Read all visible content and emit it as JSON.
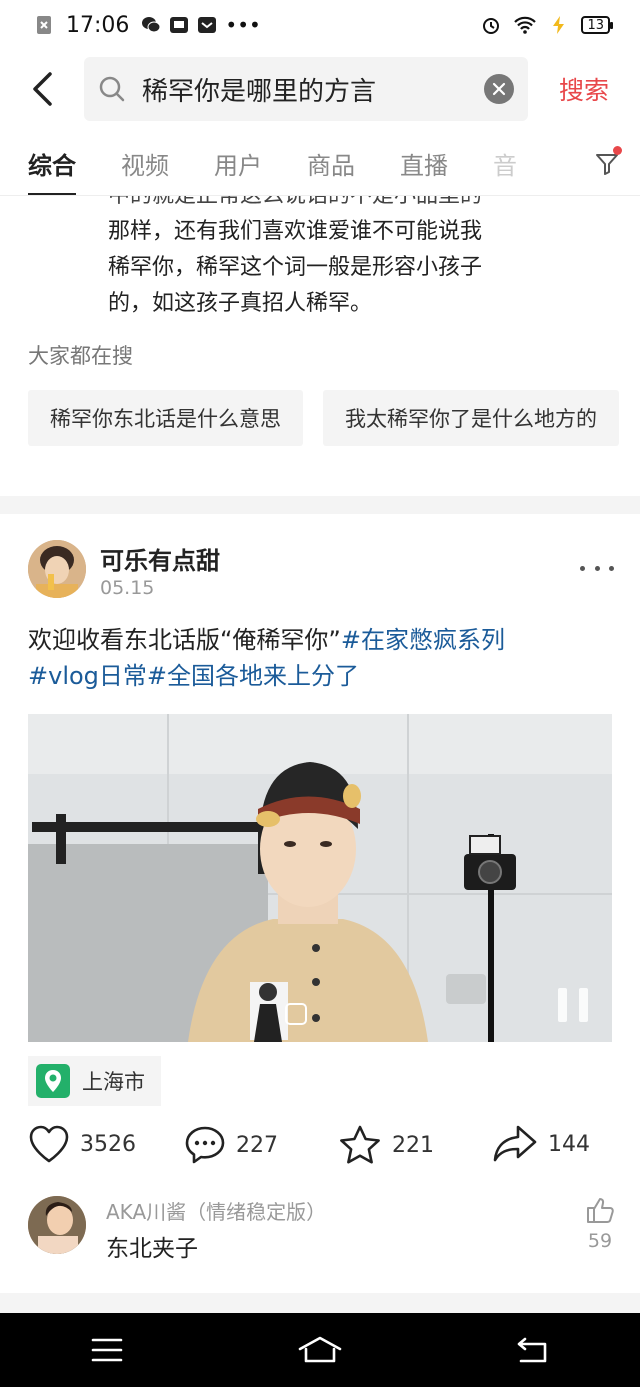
{
  "status_bar": {
    "time": "17:06",
    "battery": "13"
  },
  "search": {
    "query": "稀罕你是哪里的方言",
    "submit_label": "搜索"
  },
  "tabs": [
    {
      "label": "综合"
    },
    {
      "label": "视频"
    },
    {
      "label": "用户"
    },
    {
      "label": "商品"
    },
    {
      "label": "直播"
    },
    {
      "label": "音"
    }
  ],
  "answer_snippet": {
    "partial_line": "中的就是正常这么说话的不是小品里的",
    "lines": [
      "那样，还有我们喜欢谁爱谁不可能说我",
      "稀罕你，稀罕这个词一般是形容小孩子",
      "的，如这孩子真招人稀罕。"
    ]
  },
  "related": {
    "title": "大家都在搜",
    "items": [
      "稀罕你东北话是什么意思",
      "我太稀罕你了是什么地方的"
    ]
  },
  "post": {
    "author": "可乐有点甜",
    "date": "05.15",
    "text_plain": "欢迎收看东北话版“俺稀罕你”",
    "hashtags": [
      "#在家憋疯系列",
      "#vlog日常",
      "#全国各地来上分了"
    ],
    "location": "上海市",
    "likes": "3526",
    "comments": "227",
    "favorites": "221",
    "shares": "144"
  },
  "top_comment": {
    "user": "AKA川酱（情绪稳定版）",
    "text": "东北夹子",
    "likes": "59"
  }
}
